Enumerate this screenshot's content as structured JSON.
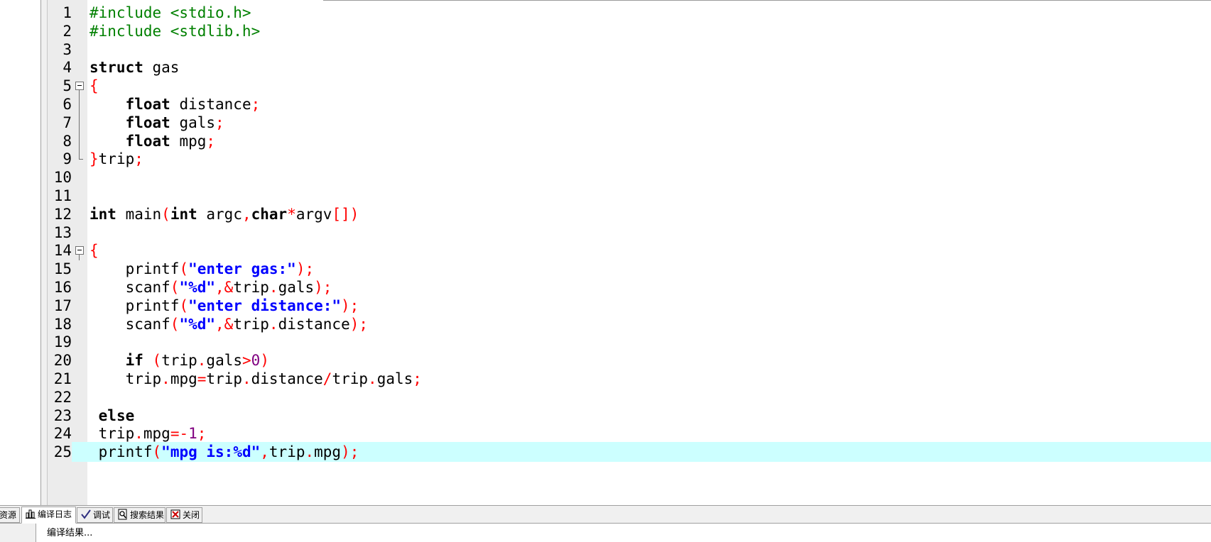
{
  "editor": {
    "lines": [
      {
        "n": "1",
        "tokens": [
          [
            "pre",
            "#include <stdio.h>"
          ]
        ]
      },
      {
        "n": "2",
        "tokens": [
          [
            "pre",
            "#include <stdlib.h>"
          ]
        ]
      },
      {
        "n": "3",
        "tokens": []
      },
      {
        "n": "4",
        "tokens": [
          [
            "kw",
            "struct"
          ],
          [
            "id",
            " gas"
          ]
        ]
      },
      {
        "n": "5",
        "fold": "box",
        "tokens": [
          [
            "sym",
            "{"
          ]
        ]
      },
      {
        "n": "6",
        "fold": "line",
        "tokens": [
          [
            "id",
            "    "
          ],
          [
            "kw",
            "float"
          ],
          [
            "id",
            " distance"
          ],
          [
            "sym",
            ";"
          ]
        ]
      },
      {
        "n": "7",
        "fold": "line",
        "tokens": [
          [
            "id",
            "    "
          ],
          [
            "kw",
            "float"
          ],
          [
            "id",
            " gals"
          ],
          [
            "sym",
            ";"
          ]
        ]
      },
      {
        "n": "8",
        "fold": "line",
        "tokens": [
          [
            "id",
            "    "
          ],
          [
            "kw",
            "float"
          ],
          [
            "id",
            " mpg"
          ],
          [
            "sym",
            ";"
          ]
        ]
      },
      {
        "n": "9",
        "fold": "end",
        "tokens": [
          [
            "sym",
            "}"
          ],
          [
            "id",
            "trip"
          ],
          [
            "sym",
            ";"
          ]
        ]
      },
      {
        "n": "10",
        "tokens": []
      },
      {
        "n": "11",
        "tokens": []
      },
      {
        "n": "12",
        "tokens": [
          [
            "kw",
            "int"
          ],
          [
            "id",
            " main"
          ],
          [
            "sym",
            "("
          ],
          [
            "kw",
            "int"
          ],
          [
            "id",
            " argc"
          ],
          [
            "sym",
            ","
          ],
          [
            "kw",
            "char"
          ],
          [
            "sym",
            "*"
          ],
          [
            "id",
            "argv"
          ],
          [
            "sym",
            "[])"
          ]
        ]
      },
      {
        "n": "13",
        "tokens": []
      },
      {
        "n": "14",
        "fold": "box",
        "tokens": [
          [
            "sym",
            "{"
          ]
        ]
      },
      {
        "n": "15",
        "tokens": [
          [
            "id",
            "    printf"
          ],
          [
            "sym",
            "("
          ],
          [
            "str",
            "\"enter gas:\""
          ],
          [
            "sym",
            ");"
          ]
        ]
      },
      {
        "n": "16",
        "tokens": [
          [
            "id",
            "    scanf"
          ],
          [
            "sym",
            "("
          ],
          [
            "str",
            "\"%d\""
          ],
          [
            "sym",
            ",&"
          ],
          [
            "id",
            "trip"
          ],
          [
            "sym",
            "."
          ],
          [
            "id",
            "gals"
          ],
          [
            "sym",
            ");"
          ]
        ]
      },
      {
        "n": "17",
        "tokens": [
          [
            "id",
            "    printf"
          ],
          [
            "sym",
            "("
          ],
          [
            "str",
            "\"enter distance:\""
          ],
          [
            "sym",
            ");"
          ]
        ]
      },
      {
        "n": "18",
        "tokens": [
          [
            "id",
            "    scanf"
          ],
          [
            "sym",
            "("
          ],
          [
            "str",
            "\"%d\""
          ],
          [
            "sym",
            ",&"
          ],
          [
            "id",
            "trip"
          ],
          [
            "sym",
            "."
          ],
          [
            "id",
            "distance"
          ],
          [
            "sym",
            ");"
          ]
        ]
      },
      {
        "n": "19",
        "tokens": []
      },
      {
        "n": "20",
        "tokens": [
          [
            "id",
            "    "
          ],
          [
            "kw",
            "if"
          ],
          [
            "id",
            " "
          ],
          [
            "sym",
            "("
          ],
          [
            "id",
            "trip"
          ],
          [
            "sym",
            "."
          ],
          [
            "id",
            "gals"
          ],
          [
            "sym",
            ">"
          ],
          [
            "num",
            "0"
          ],
          [
            "sym",
            ")"
          ]
        ]
      },
      {
        "n": "21",
        "tokens": [
          [
            "id",
            "    trip"
          ],
          [
            "sym",
            "."
          ],
          [
            "id",
            "mpg"
          ],
          [
            "sym",
            "="
          ],
          [
            "id",
            "trip"
          ],
          [
            "sym",
            "."
          ],
          [
            "id",
            "distance"
          ],
          [
            "sym",
            "/"
          ],
          [
            "id",
            "trip"
          ],
          [
            "sym",
            "."
          ],
          [
            "id",
            "gals"
          ],
          [
            "sym",
            ";"
          ]
        ]
      },
      {
        "n": "22",
        "tokens": []
      },
      {
        "n": "23",
        "tokens": [
          [
            "id",
            " "
          ],
          [
            "kw",
            "else"
          ]
        ]
      },
      {
        "n": "24",
        "tokens": [
          [
            "id",
            " trip"
          ],
          [
            "sym",
            "."
          ],
          [
            "id",
            "mpg"
          ],
          [
            "sym",
            "=-"
          ],
          [
            "num",
            "1"
          ],
          [
            "sym",
            ";"
          ]
        ]
      },
      {
        "n": "25",
        "current": true,
        "tokens": [
          [
            "id",
            " printf"
          ],
          [
            "sym",
            "("
          ],
          [
            "str",
            "\"mpg is:%d\""
          ],
          [
            "sym",
            ","
          ],
          [
            "id",
            "trip"
          ],
          [
            "sym",
            "."
          ],
          [
            "id",
            "mpg"
          ],
          [
            "sym",
            ");"
          ]
        ]
      }
    ]
  },
  "tabs": [
    {
      "label": "资源",
      "icon": "none"
    },
    {
      "label": "编译日志",
      "icon": "bar-chart-icon",
      "active": true
    },
    {
      "label": "调试",
      "icon": "checkmark-icon"
    },
    {
      "label": "搜索结果",
      "icon": "search-document-icon"
    },
    {
      "label": "关闭",
      "icon": "close-window-icon"
    }
  ],
  "output": {
    "text": "编译结果..."
  },
  "colors": {
    "preprocessor": "#008000",
    "keyword": "#000000",
    "symbol": "#ff0000",
    "string": "#0000ff",
    "number": "#800080",
    "current_line": "#ccffff"
  }
}
